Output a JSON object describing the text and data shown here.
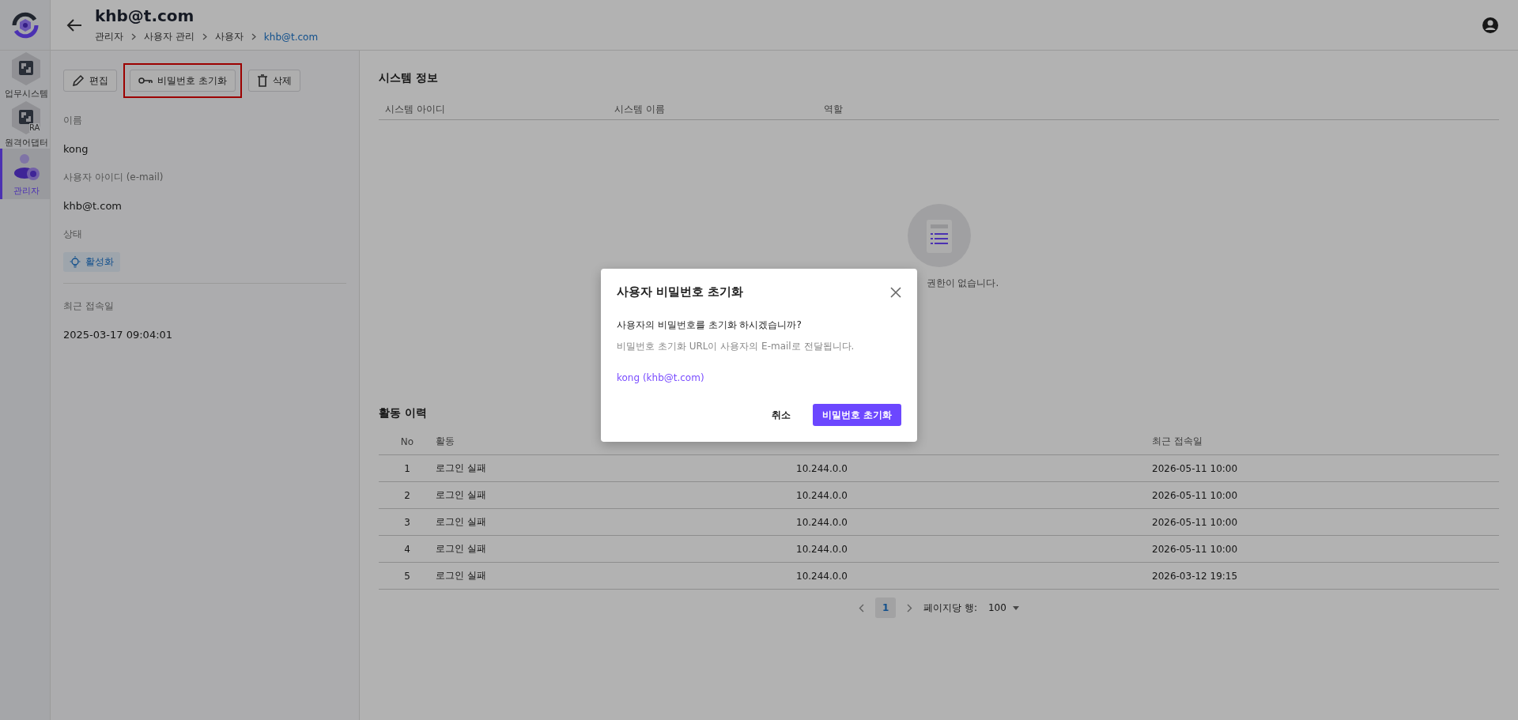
{
  "rail": {
    "items": [
      {
        "label": "업무시스템",
        "selected": false,
        "kind": "system"
      },
      {
        "label": "원격어댑터",
        "badge": "RA",
        "selected": false,
        "kind": "system"
      },
      {
        "label": "관리자",
        "selected": true,
        "kind": "admin"
      }
    ]
  },
  "header": {
    "title": "khb@t.com",
    "breadcrumbs": [
      {
        "label": "관리자",
        "current": false
      },
      {
        "label": "사용자 관리",
        "current": false
      },
      {
        "label": "사용자",
        "current": false
      },
      {
        "label": "khb@t.com",
        "current": true
      }
    ]
  },
  "user_panel": {
    "actions": [
      {
        "label": "편집",
        "kind": "edit",
        "highlighted": false
      },
      {
        "label": "비밀번호 초기화",
        "kind": "key",
        "highlighted": true
      },
      {
        "label": "삭제",
        "kind": "delete",
        "highlighted": false
      }
    ],
    "fields": [
      {
        "label": "이름",
        "value": "kong",
        "kind": "text"
      },
      {
        "label": "사용자 아이디 (e-mail)",
        "value": "khb@t.com",
        "kind": "text"
      },
      {
        "label": "상태",
        "value": "활성화",
        "kind": "status"
      },
      {
        "label": "최근 접속일",
        "value": "2025-03-17 09:04:01",
        "kind": "text"
      }
    ]
  },
  "system_info": {
    "title": "시스템 정보",
    "columns": [
      "시스템 아이디",
      "시스템 이름",
      "역할"
    ],
    "empty_text": "권한이 없습니다."
  },
  "activity": {
    "title": "활동 이력",
    "columns": [
      "No",
      "활동",
      "",
      "최근 접속일"
    ],
    "rows": [
      [
        "1",
        "로그인 실패",
        "10.244.0.0",
        "2026-05-11 10:00"
      ],
      [
        "2",
        "로그인 실패",
        "10.244.0.0",
        "2026-05-11 10:00"
      ],
      [
        "3",
        "로그인 실패",
        "10.244.0.0",
        "2026-05-11 10:00"
      ],
      [
        "4",
        "로그인 실패",
        "10.244.0.0",
        "2026-05-11 10:00"
      ],
      [
        "5",
        "로그인 실패",
        "10.244.0.0",
        "2026-03-12 19:15"
      ]
    ],
    "pagination": {
      "pages": [
        {
          "label": "1",
          "selected": true
        }
      ],
      "rows_per_page_label": "페이지당 행:",
      "rows_per_page": "100"
    }
  },
  "dialog": {
    "title": "사용자 비밀번호 초기화",
    "question": "사용자의 비밀번호를 초기화 하시겠습니까?",
    "note": "비밀번호 초기화 URL이 사용자의 E-mail로 전달됩니다.",
    "target": "kong (khb@t.com)",
    "buttons": [
      {
        "label": "취소",
        "primary": false
      },
      {
        "label": "비밀번호 초기화",
        "primary": true
      }
    ]
  }
}
